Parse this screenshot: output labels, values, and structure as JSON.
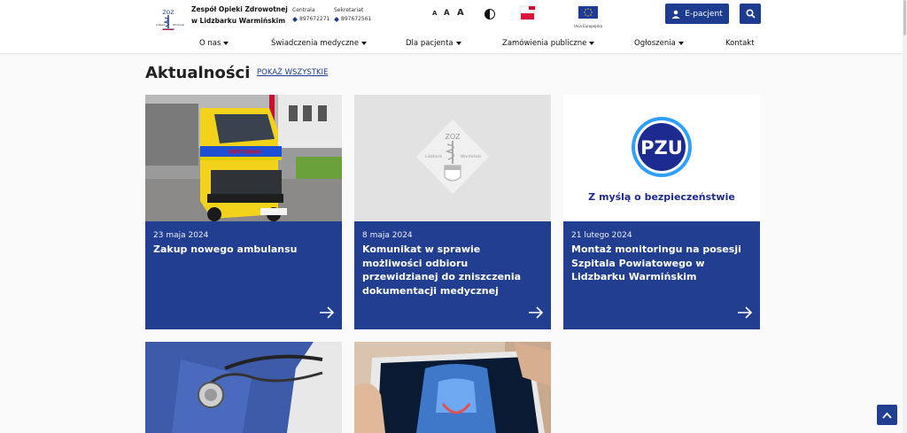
{
  "header": {
    "org_line1": "Zespół Opieki Zdrowotnej",
    "org_line2": "w Lidzbarku Warmińskim",
    "centrala_label": "Centrala",
    "centrala_phone": "897672271",
    "sekretariat_label": "Sekretariat",
    "sekretariat_phone": "897672561",
    "font_size_buttons": [
      "A",
      "A",
      "A"
    ],
    "eu_caption": "Unia Europejska",
    "epatient_label": "E-pacjent"
  },
  "nav": {
    "items": [
      {
        "label": "O nas",
        "dropdown": true
      },
      {
        "label": "Świadczenia medyczne",
        "dropdown": true
      },
      {
        "label": "Dla pacjenta",
        "dropdown": true
      },
      {
        "label": "Zamówienia publiczne",
        "dropdown": true
      },
      {
        "label": "Ogłoszenia",
        "dropdown": true
      },
      {
        "label": "Kontakt",
        "dropdown": false
      }
    ]
  },
  "news": {
    "title": "Aktualności",
    "show_all": "POKAŻ WSZYSTKIE",
    "cards": [
      {
        "date": "23 maja 2024",
        "title": "Zakup nowego ambulansu",
        "image": "ambulance-photo",
        "van_text": "AMBULANS"
      },
      {
        "date": "8 maja 2024",
        "title": "Komunikat w sprawie możliwości odbioru przewidzianej do zniszczenia dokumentacji medycznej",
        "image": "zoz-logo-placeholder",
        "logo_text": "ZOZ",
        "logo_left": "Lidzbark",
        "logo_right": "Warmiński"
      },
      {
        "date": "21 lutego 2024",
        "title": "Montaż monitoringu na posesji Szpitala Powiatowego w Lidzbarku Warmińskim",
        "image": "pzu-logo",
        "pzu_text": "PZU",
        "tagline": "Z myślą o bezpieczeństwie"
      },
      {
        "image": "stethoscope-photo"
      },
      {
        "image": "xray-tablet-photo"
      }
    ]
  },
  "colors": {
    "primary": "#213e91",
    "header_bg": "#ffffff",
    "page_bg": "#fafafa"
  }
}
